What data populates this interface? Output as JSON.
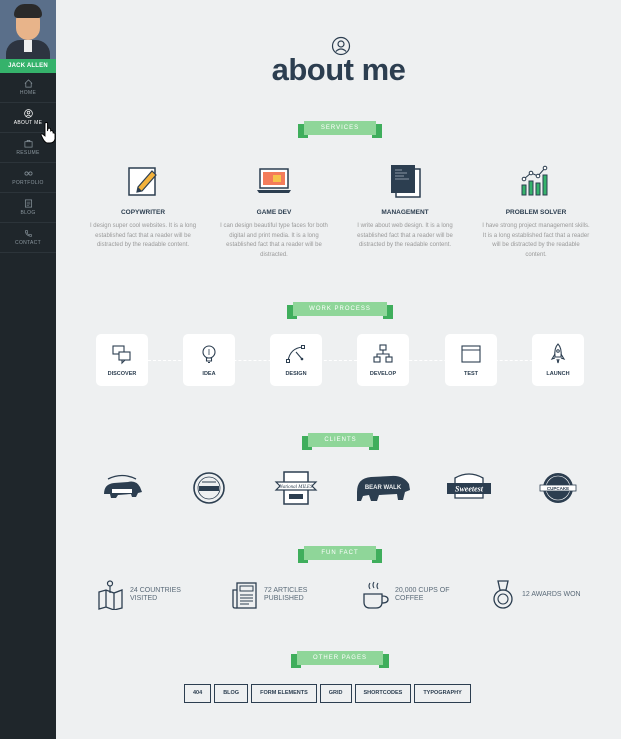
{
  "sidebar": {
    "name": "JACK ALLEN",
    "items": [
      {
        "label": "HOME",
        "icon": "home-icon"
      },
      {
        "label": "ABOUT ME",
        "icon": "user-icon"
      },
      {
        "label": "RESUME",
        "icon": "briefcase-icon"
      },
      {
        "label": "PORTFOLIO",
        "icon": "glasses-icon"
      },
      {
        "label": "BLOG",
        "icon": "image-icon"
      },
      {
        "label": "CONTACT",
        "icon": "phone-icon"
      }
    ],
    "active": "ABOUT ME"
  },
  "header": {
    "title": "about me",
    "icon": "user-circle-icon"
  },
  "services": {
    "ribbon": "SERVICES",
    "items": [
      {
        "title": "COPYWRITER",
        "text": "I design super cool websites. It is a long established fact that a reader will be distracted by the readable content.",
        "icon": "pencil-note-icon"
      },
      {
        "title": "GAME DEV",
        "text": "I can design beautiful type faces for both digital and print media. It is a long established fact that a reader will be distracted.",
        "icon": "laptop-icon"
      },
      {
        "title": "MANAGEMENT",
        "text": "I write about web design. It is a long established fact that a reader will be distracted by the readable content.",
        "icon": "documents-icon"
      },
      {
        "title": "PROBLEM SOLVER",
        "text": "I have strong project management skills. It is a long established fact that a reader will be distracted by the readable content.",
        "icon": "chart-icon"
      }
    ]
  },
  "work_process": {
    "ribbon": "WORK PROCESS",
    "steps": [
      {
        "label": "DISCOVER",
        "icon": "chat-icon"
      },
      {
        "label": "IDEA",
        "icon": "bulb-icon"
      },
      {
        "label": "DESIGN",
        "icon": "pen-tool-icon"
      },
      {
        "label": "DEVELOP",
        "icon": "sitemap-icon"
      },
      {
        "label": "TEST",
        "icon": "browser-icon"
      },
      {
        "label": "LAUNCH",
        "icon": "rocket-icon"
      }
    ]
  },
  "clients": {
    "ribbon": "CLIENTS",
    "logos": [
      {
        "name": "bear-logo-1",
        "text": ""
      },
      {
        "name": "circle-badge-logo",
        "text": ""
      },
      {
        "name": "national-miles-logo",
        "text": "National MILES"
      },
      {
        "name": "bear-walk-logo",
        "text": "BEAR WALK"
      },
      {
        "name": "sweetest-logo",
        "text": "Sweetest"
      },
      {
        "name": "cupcake-logo",
        "text": "CUPCAKE"
      }
    ]
  },
  "fun_fact": {
    "ribbon": "FUN FACT",
    "items": [
      {
        "text": "24 COUNTRIES VISITED",
        "icon": "map-icon"
      },
      {
        "text": "72 ARTICLES PUBLISHED",
        "icon": "newspaper-icon"
      },
      {
        "text": "20,000 CUPS OF COFFEE",
        "icon": "coffee-icon"
      },
      {
        "text": "12 AWARDS WON",
        "icon": "medal-icon"
      }
    ]
  },
  "other_pages": {
    "ribbon": "OTHER PAGES",
    "links": [
      "404",
      "BLOG",
      "FORM ELEMENTS",
      "GRID",
      "SHORTCODES",
      "TYPOGRAPHY"
    ]
  },
  "colors": {
    "accent": "#35b26b",
    "ribbon": "#8fd699",
    "ribbon_dark": "#3fae5c",
    "sidebar": "#1f262b",
    "text": "#2c3e50"
  }
}
